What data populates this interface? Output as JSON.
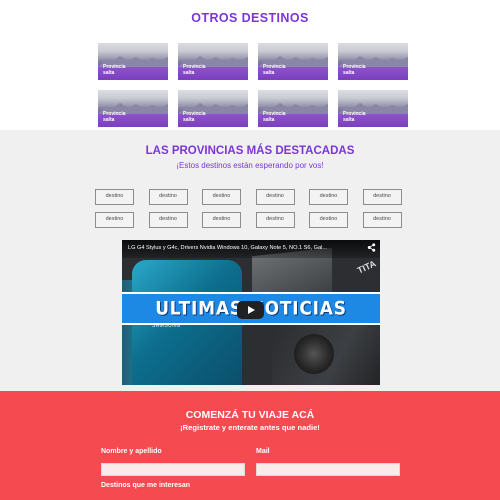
{
  "otros_destinos": {
    "title": "OTROS DESTINOS",
    "cards": [
      {
        "label": "Provincia\nsalta"
      },
      {
        "label": "Provincia\nsalta"
      },
      {
        "label": "Provincia\nsalta"
      },
      {
        "label": "Provincia\nsalta"
      },
      {
        "label": "Provincia\nsalta"
      },
      {
        "label": "Provincia\nsalta"
      },
      {
        "label": "Provincia\nsalta"
      },
      {
        "label": "Provincia\nsalta"
      }
    ]
  },
  "provincias": {
    "title": "LAS PROVINCIAS MÁS DESTACADAS",
    "subtitle": "¡Estos destinos están esperando por vos!",
    "destinos": [
      "destino",
      "destino",
      "destino",
      "destino",
      "destino",
      "destino",
      "destino",
      "destino",
      "destino",
      "destino",
      "destino",
      "destino"
    ],
    "video": {
      "title": "LG G4 Stylus y G4c, Drivers Nvidia Windows 10, Galaxy Note 5, NO.1 S6, Gal...",
      "banner": "ULTIMAS NOTICIAS",
      "brand_text": "SAMSUNG",
      "gpu_text": "TITA",
      "share_icon": "share-icon",
      "play_icon": "play-icon",
      "banner_color": "#1e88e5"
    }
  },
  "registro": {
    "title": "COMENZÁ TU VIAJE ACÁ",
    "subtitle": "¡Registrate y enterate antes que nadie!",
    "nombre_label": "Nombre y apellido",
    "nombre_value": "",
    "mail_label": "Mail",
    "mail_value": "",
    "destinos_label": "Destinos que me interesan",
    "background_color": "#f54a50"
  },
  "colors": {
    "accent": "#7b35d9"
  }
}
